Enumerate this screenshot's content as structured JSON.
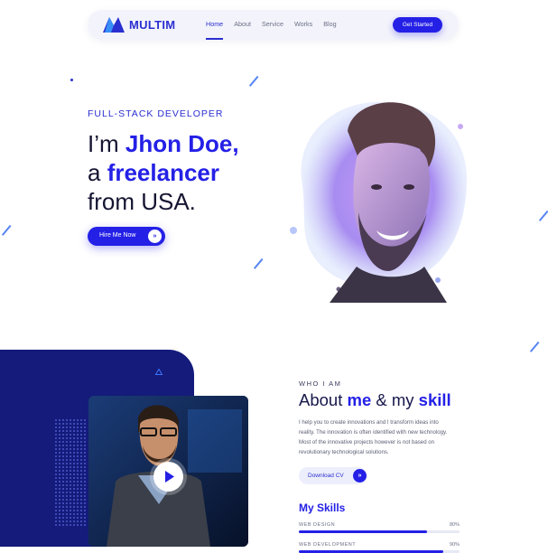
{
  "nav": {
    "brand": "MULTIM",
    "links": [
      {
        "label": "Home"
      },
      {
        "label": "About"
      },
      {
        "label": "Service"
      },
      {
        "label": "Works"
      },
      {
        "label": "Blog"
      }
    ],
    "cta": "Get Started"
  },
  "hero": {
    "subtitle": "FULL-STACK DEVELOPER",
    "line1_prefix": "I’m ",
    "line1_highlight": "Jhon Doe,",
    "line2_prefix": "a ",
    "line2_highlight": "freelancer",
    "line3": "from USA.",
    "button": "Hire Me Now",
    "button_icon": "»"
  },
  "about": {
    "kicker": "WHO I AM",
    "title_a": "About ",
    "title_b": "me",
    "title_c": " & my ",
    "title_d": "skill",
    "text": "I help you to create innovations and I transform ideas into reality. The innovation is often identified with new technology. Most of the innovative projects however is not based on revolutionary technological solutions.",
    "cv_button": "Download CV",
    "cv_icon": "»",
    "skills_title": "My Skills",
    "skills": [
      {
        "name": "WEB DESIGN",
        "pct_label": "80%",
        "value": 0.8
      },
      {
        "name": "WEB DEVELOPMENT",
        "pct_label": "90%",
        "value": 0.9
      }
    ]
  },
  "colors": {
    "accent": "#2420e6",
    "panel": "#141b7a"
  }
}
